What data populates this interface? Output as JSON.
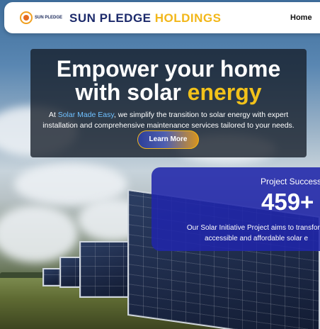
{
  "header": {
    "logo_text": "SUN PLEDGE",
    "brand_part1": "SUN PLEDGE",
    "brand_part2": "HOLDINGS",
    "nav_home": "Home"
  },
  "hero": {
    "title_line1": "Empower your home",
    "title_line2_prefix": "with solar",
    "title_highlight": "energy",
    "desc_prefix": "At",
    "desc_link": "Solar Made Easy",
    "desc_rest": ", we simplify the transition to solar energy with expert installation and comprehensive maintenance services tailored to your needs.",
    "cta_label": "Learn More"
  },
  "success": {
    "title": "Project Success",
    "count": "459+",
    "desc_line1": "Our Solar Initiative Project aims to transform",
    "desc_line2": "accessible and affordable solar e"
  },
  "colors": {
    "brand_navy": "#1c2a6b",
    "brand_gold": "#f2b71a",
    "success_bg": "#2026aa",
    "link_blue": "#6fc0ff"
  }
}
